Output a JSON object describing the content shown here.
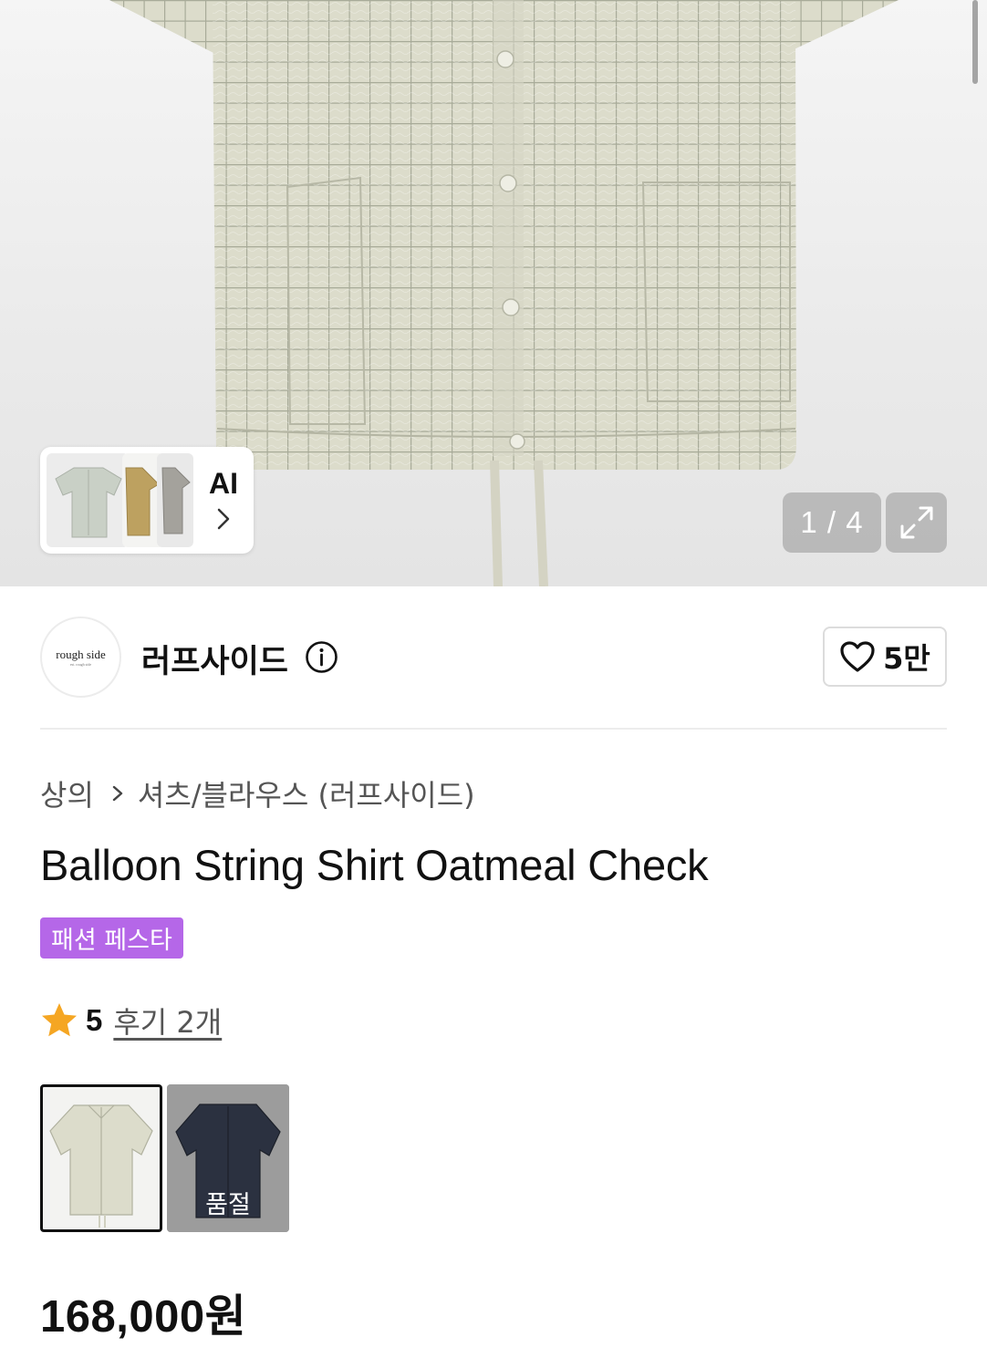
{
  "gallery": {
    "counter": "1 / 4",
    "ai_label": "AI"
  },
  "brand": {
    "logo_text": "rough side",
    "logo_subtext": "est. rough side",
    "name": "러프사이드",
    "likes": "5만"
  },
  "breadcrumb": [
    "상의",
    "셔츠/블라우스 (러프사이드)"
  ],
  "product": {
    "title": "Balloon String Shirt Oatmeal Check",
    "badge": "패션 페스타",
    "rating": "5",
    "reviews": "후기 2개",
    "price": "168,000원"
  },
  "swatches": [
    {
      "color": "oatmeal check",
      "selected": true
    },
    {
      "color": "navy",
      "soldout_label": "품절"
    }
  ],
  "colors": {
    "badge": "#b567e8",
    "star": "#f5a623",
    "shirt": "#dcdccc",
    "navy_shirt": "#2b3140"
  },
  "icons": [
    "ai-recommend-thumbnails",
    "chevron-right-icon",
    "expand-icon",
    "info-icon",
    "heart-icon",
    "star-icon"
  ]
}
